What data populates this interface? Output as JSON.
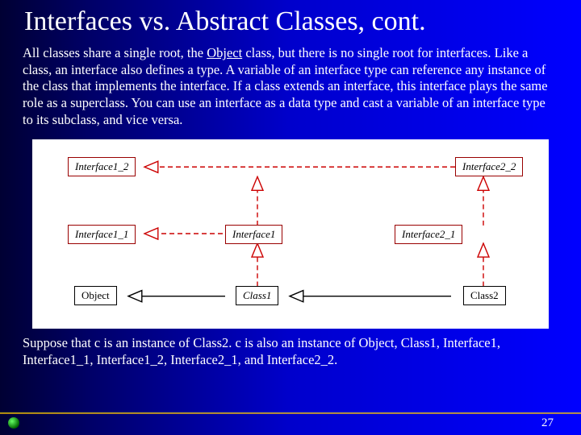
{
  "title": "Interfaces vs. Abstract Classes, cont.",
  "para1_a": "All classes share a single root, the ",
  "para1_obj": "Object",
  "para1_b": " class, but there is no single root for interfaces. Like a class, an interface also defines a type. A variable of an interface type can reference any instance of the class that implements the interface. If a class extends an interface, this interface plays the same role as a superclass. You can use an interface as a data type and cast a variable of an interface type to its subclass, and vice versa.",
  "para2": "Suppose that c is an instance of Class2. c is also an instance of Object, Class1, Interface1, Interface1_1, Interface1_2, Interface2_1, and Interface2_2.",
  "pagenum": "27",
  "nodes": {
    "if12": "Interface1_2",
    "if22": "Interface2_2",
    "if11": "Interface1_1",
    "if1": "Interface1",
    "if21": "Interface2_1",
    "obj": "Object",
    "c1": "Class1",
    "c2": "Class2"
  }
}
